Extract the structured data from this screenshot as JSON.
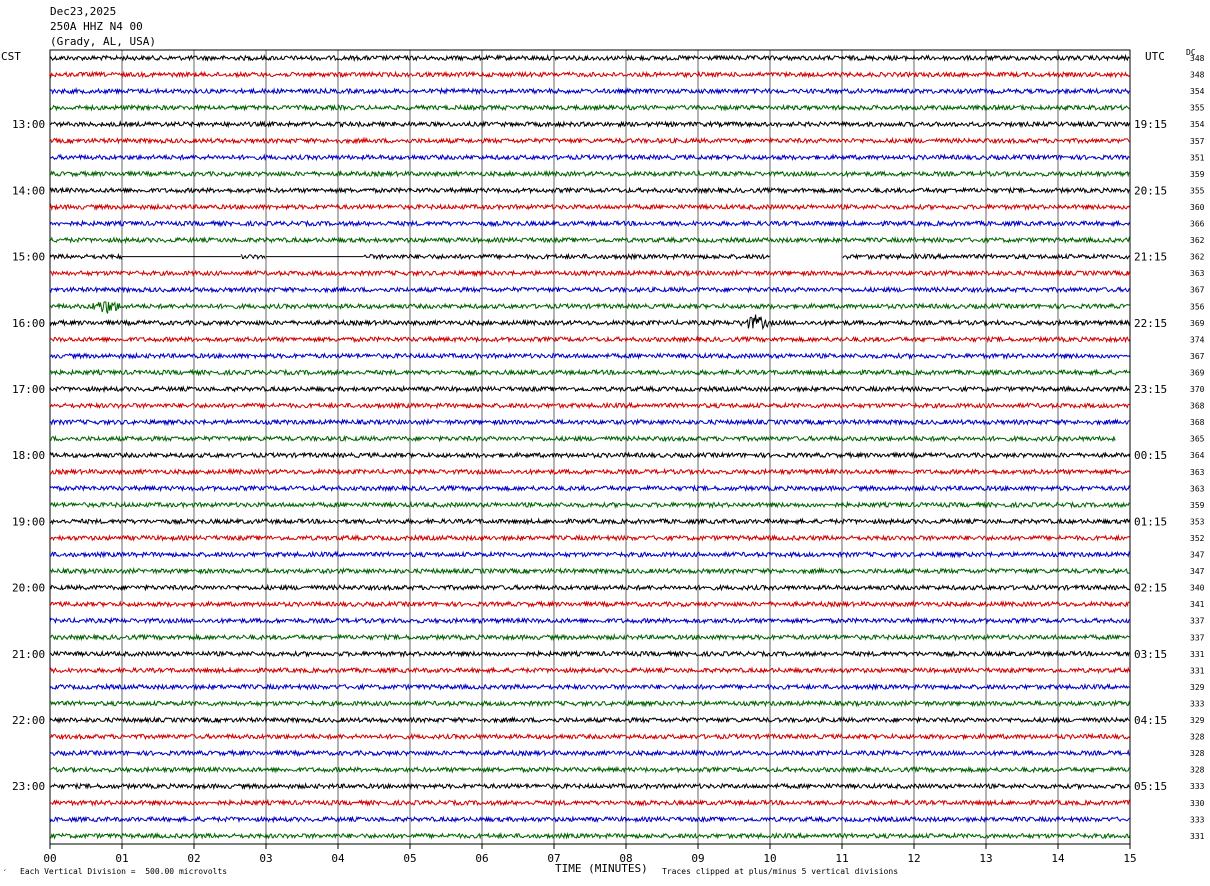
{
  "header": {
    "date": "Dec23,2025",
    "station": "250A HHZ N4 00",
    "location": "(Grady, AL, USA)"
  },
  "labels": {
    "left_timezone": "CST",
    "right_timezone": "UTC",
    "dc_label": "DC",
    "xlabel": "TIME (MINUTES)",
    "scale_note": "Each Vertical Division =  500.00 microvolts",
    "clip_note": "Traces clipped at plus/minus 5 vertical divisions",
    "corner_mark": "´"
  },
  "colors": {
    "trace_cycle": [
      "#000000",
      "#d40000",
      "#0000c8",
      "#006400"
    ],
    "grid": "#000000"
  },
  "chart_data": {
    "type": "line",
    "title": "",
    "xlabel": "TIME (MINUTES)",
    "xlim": [
      0,
      15
    ],
    "x_ticks": [
      "00",
      "01",
      "02",
      "03",
      "04",
      "05",
      "06",
      "07",
      "08",
      "09",
      "10",
      "11",
      "12",
      "13",
      "14",
      "15"
    ],
    "traces_per_hour": 4,
    "left_hour_labels": [
      "13:00",
      "14:00",
      "15:00",
      "16:00",
      "17:00",
      "18:00",
      "19:00",
      "20:00",
      "21:00",
      "22:00",
      "23:00"
    ],
    "right_hour_labels": [
      "19:15",
      "20:15",
      "21:15",
      "22:15",
      "23:15",
      "00:15",
      "01:15",
      "02:15",
      "03:15",
      "04:15",
      "05:15"
    ],
    "dc_offsets": [
      "348",
      "348",
      "354",
      "355",
      "354",
      "357",
      "351",
      "359",
      "355",
      "360",
      "366",
      "362",
      "362",
      "363",
      "367",
      "356",
      "369",
      "374",
      "367",
      "369",
      "370",
      "368",
      "368",
      "365",
      "364",
      "363",
      "363",
      "359",
      "353",
      "352",
      "347",
      "347",
      "340",
      "341",
      "337",
      "337",
      "331",
      "331",
      "329",
      "333",
      "329",
      "328",
      "328",
      "328",
      "333",
      "330",
      "333",
      "331"
    ],
    "gaps": [
      {
        "trace": 12,
        "x_start": 1.0,
        "x_end": 2.65
      },
      {
        "trace": 12,
        "x_start": 3.0,
        "x_end": 4.35
      },
      {
        "trace": 12,
        "x_start": 10.0,
        "x_end": 11.0
      }
    ],
    "events": [
      {
        "trace": 15,
        "x": 0.78
      },
      {
        "trace": 16,
        "x": 9.8
      }
    ],
    "end_trace_minutes": {
      "23": 14.8
    }
  }
}
